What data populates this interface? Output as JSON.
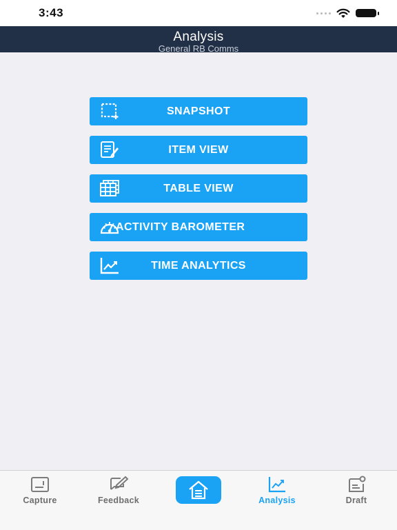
{
  "status_bar": {
    "time": "3:43"
  },
  "nav": {
    "title": "Analysis",
    "subtitle": "General RB Comms"
  },
  "menu": {
    "items": [
      {
        "label": "SNAPSHOT",
        "icon": "snapshot-icon"
      },
      {
        "label": "ITEM VIEW",
        "icon": "item-view-icon"
      },
      {
        "label": "TABLE VIEW",
        "icon": "table-view-icon"
      },
      {
        "label": "ACTIVITY BAROMETER",
        "icon": "barometer-icon"
      },
      {
        "label": "TIME ANALYTICS",
        "icon": "time-analytics-icon"
      }
    ]
  },
  "tabs": {
    "items": [
      {
        "label": "Capture",
        "icon": "capture-icon"
      },
      {
        "label": "Feedback",
        "icon": "feedback-icon"
      },
      {
        "label": "",
        "icon": "home-icon"
      },
      {
        "label": "Analysis",
        "icon": "analysis-icon",
        "active": true
      },
      {
        "label": "Draft",
        "icon": "draft-icon"
      }
    ]
  },
  "colors": {
    "accent": "#1aa2f5",
    "nav_background": "#223047",
    "page_background": "#efeff4"
  }
}
